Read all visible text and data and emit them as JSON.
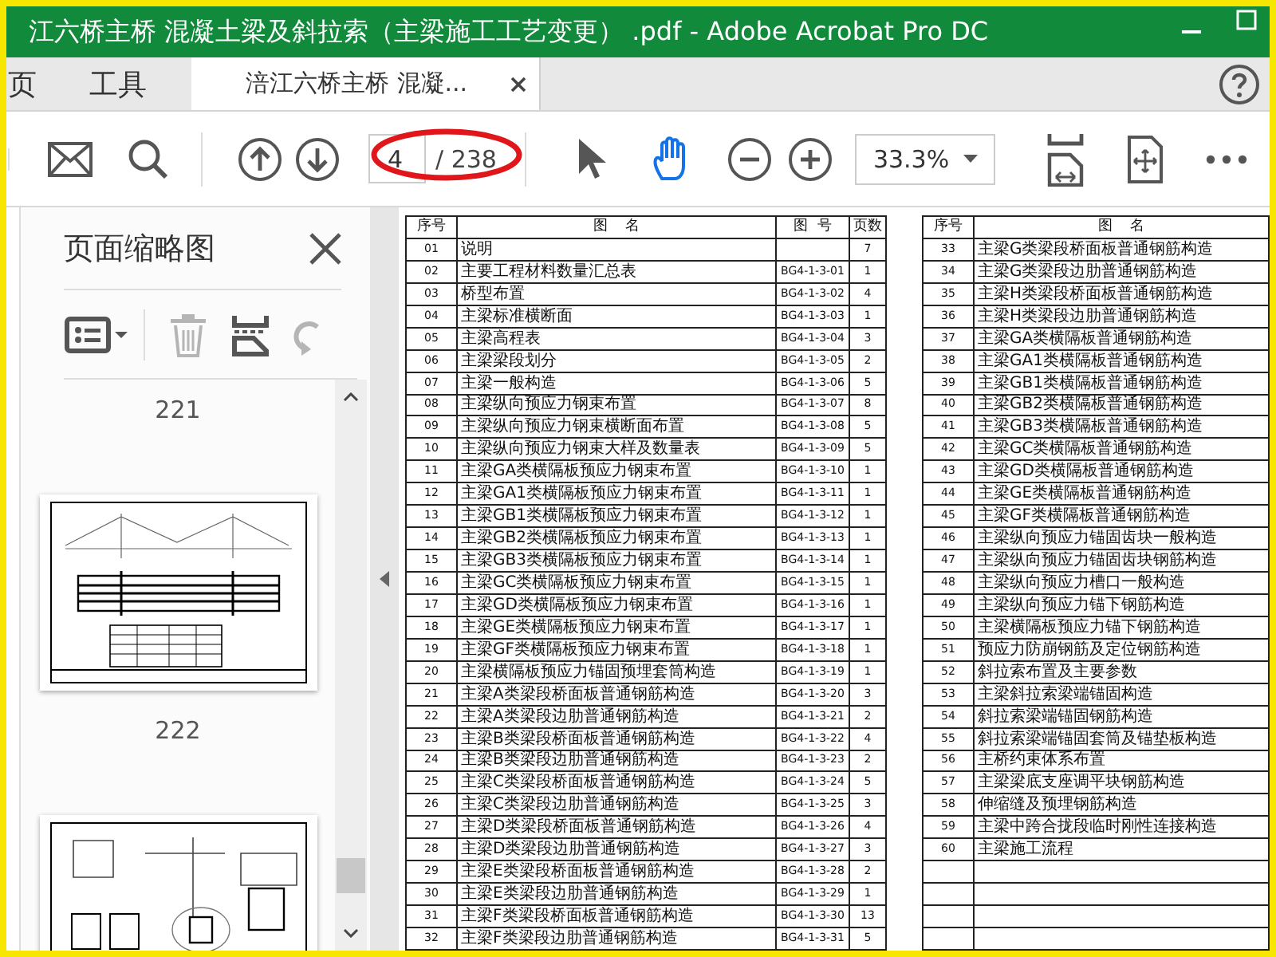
{
  "window": {
    "title": "江六桥主桥 混凝土梁及斜拉索（主梁施工工艺变更） .pdf - Adobe Acrobat Pro DC"
  },
  "tabs": [
    {
      "label": "页",
      "selected": false
    },
    {
      "label": "工具",
      "selected": false
    },
    {
      "label": "涪江六桥主桥 混凝...",
      "selected": true
    }
  ],
  "toolbar": {
    "page_field": {
      "value": "4"
    },
    "page_total": "/ 238",
    "zoom": "33.3%",
    "tools": [
      {
        "kind": "select",
        "selected": false
      },
      {
        "kind": "hand",
        "selected": true
      }
    ]
  },
  "sidebar": {
    "title": "页面缩略图",
    "tools": [
      {
        "kind": "options",
        "disabled": false
      },
      {
        "kind": "delete",
        "disabled": true
      },
      {
        "kind": "extract",
        "disabled": false
      },
      {
        "kind": "rotate",
        "disabled": true
      }
    ],
    "thumbnails": [
      {
        "page_label": "221"
      },
      {
        "page_label": "222"
      }
    ]
  },
  "document": {
    "tables": [
      {
        "columns": [
          "序号",
          "图    名",
          "图  号",
          "页数"
        ],
        "rows": [
          {
            "no": "01",
            "name": "说明",
            "pages": "7"
          },
          {
            "no": "02",
            "name": "主要工程材料数量汇总表",
            "code": "BG4-1-3-01",
            "pages": "1"
          },
          {
            "no": "03",
            "name": "桥型布置",
            "code": "BG4-1-3-02",
            "pages": "4"
          },
          {
            "no": "04",
            "name": "主梁标准横断面",
            "code": "BG4-1-3-03",
            "pages": "1"
          },
          {
            "no": "05",
            "name": "主梁高程表",
            "code": "BG4-1-3-04",
            "pages": "3"
          },
          {
            "no": "06",
            "name": "主梁梁段划分",
            "code": "BG4-1-3-05",
            "pages": "2"
          },
          {
            "no": "07",
            "name": "主梁一般构造",
            "code": "BG4-1-3-06",
            "pages": "5"
          },
          {
            "no": "08",
            "name": "主梁纵向预应力钢束布置",
            "code": "BG4-1-3-07",
            "pages": "8"
          },
          {
            "no": "09",
            "name": "主梁纵向预应力钢束横断面布置",
            "code": "BG4-1-3-08",
            "pages": "5"
          },
          {
            "no": "10",
            "name": "主梁纵向预应力钢束大样及数量表",
            "code": "BG4-1-3-09",
            "pages": "5"
          },
          {
            "no": "11",
            "name": "主梁GA类横隔板预应力钢束布置",
            "code": "BG4-1-3-10",
            "pages": "1"
          },
          {
            "no": "12",
            "name": "主梁GA1类横隔板预应力钢束布置",
            "code": "BG4-1-3-11",
            "pages": "1"
          },
          {
            "no": "13",
            "name": "主梁GB1类横隔板预应力钢束布置",
            "code": "BG4-1-3-12",
            "pages": "1"
          },
          {
            "no": "14",
            "name": "主梁GB2类横隔板预应力钢束布置",
            "code": "BG4-1-3-13",
            "pages": "1"
          },
          {
            "no": "15",
            "name": "主梁GB3类横隔板预应力钢束布置",
            "code": "BG4-1-3-14",
            "pages": "1"
          },
          {
            "no": "16",
            "name": "主梁GC类横隔板预应力钢束布置",
            "code": "BG4-1-3-15",
            "pages": "1"
          },
          {
            "no": "17",
            "name": "主梁GD类横隔板预应力钢束布置",
            "code": "BG4-1-3-16",
            "pages": "1"
          },
          {
            "no": "18",
            "name": "主梁GE类横隔板预应力钢束布置",
            "code": "BG4-1-3-17",
            "pages": "1"
          },
          {
            "no": "19",
            "name": "主梁GF类横隔板预应力钢束布置",
            "code": "BG4-1-3-18",
            "pages": "1"
          },
          {
            "no": "20",
            "name": "主梁横隔板预应力锚固预埋套筒构造",
            "code": "BG4-1-3-19",
            "pages": "1"
          },
          {
            "no": "21",
            "name": "主梁A类梁段桥面板普通钢筋构造",
            "code": "BG4-1-3-20",
            "pages": "3"
          },
          {
            "no": "22",
            "name": "主梁A类梁段边肋普通钢筋构造",
            "code": "BG4-1-3-21",
            "pages": "2"
          },
          {
            "no": "23",
            "name": "主梁B类梁段桥面板普通钢筋构造",
            "code": "BG4-1-3-22",
            "pages": "4"
          },
          {
            "no": "24",
            "name": "主梁B类梁段边肋普通钢筋构造",
            "code": "BG4-1-3-23",
            "pages": "2"
          },
          {
            "no": "25",
            "name": "主梁C类梁段桥面板普通钢筋构造",
            "code": "BG4-1-3-24",
            "pages": "5"
          },
          {
            "no": "26",
            "name": "主梁C类梁段边肋普通钢筋构造",
            "code": "BG4-1-3-25",
            "pages": "3"
          },
          {
            "no": "27",
            "name": "主梁D类梁段桥面板普通钢筋构造",
            "code": "BG4-1-3-26",
            "pages": "4"
          },
          {
            "no": "28",
            "name": "主梁D类梁段边肋普通钢筋构造",
            "code": "BG4-1-3-27",
            "pages": "3"
          },
          {
            "no": "29",
            "name": "主梁E类梁段桥面板普通钢筋构造",
            "code": "BG4-1-3-28",
            "pages": "2"
          },
          {
            "no": "30",
            "name": "主梁E类梁段边肋普通钢筋构造",
            "code": "BG4-1-3-29",
            "pages": "1"
          },
          {
            "no": "31",
            "name": "主梁F类梁段桥面板普通钢筋构造",
            "code": "BG4-1-3-30",
            "pages": "13"
          },
          {
            "no": "32",
            "name": "主梁F类梁段边肋普通钢筋构造",
            "code": "BG4-1-3-31",
            "pages": "5"
          }
        ]
      },
      {
        "columns": [
          "序号",
          "图    名"
        ],
        "rows": [
          {
            "no": "33",
            "name": "主梁G类梁段桥面板普通钢筋构造"
          },
          {
            "no": "34",
            "name": "主梁G类梁段边肋普通钢筋构造"
          },
          {
            "no": "35",
            "name": "主梁H类梁段桥面板普通钢筋构造"
          },
          {
            "no": "36",
            "name": "主梁H类梁段边肋普通钢筋构造"
          },
          {
            "no": "37",
            "name": "主梁GA类横隔板普通钢筋构造"
          },
          {
            "no": "38",
            "name": "主梁GA1类横隔板普通钢筋构造"
          },
          {
            "no": "39",
            "name": "主梁GB1类横隔板普通钢筋构造"
          },
          {
            "no": "40",
            "name": "主梁GB2类横隔板普通钢筋构造"
          },
          {
            "no": "41",
            "name": "主梁GB3类横隔板普通钢筋构造"
          },
          {
            "no": "42",
            "name": "主梁GC类横隔板普通钢筋构造"
          },
          {
            "no": "43",
            "name": "主梁GD类横隔板普通钢筋构造"
          },
          {
            "no": "44",
            "name": "主梁GE类横隔板普通钢筋构造"
          },
          {
            "no": "45",
            "name": "主梁GF类横隔板普通钢筋构造"
          },
          {
            "no": "46",
            "name": "主梁纵向预应力锚固齿块一般构造"
          },
          {
            "no": "47",
            "name": "主梁纵向预应力锚固齿块钢筋构造"
          },
          {
            "no": "48",
            "name": "主梁纵向预应力槽口一般构造"
          },
          {
            "no": "49",
            "name": "主梁纵向预应力锚下钢筋构造"
          },
          {
            "no": "50",
            "name": "主梁横隔板预应力锚下钢筋构造"
          },
          {
            "no": "51",
            "name": "预应力防崩钢筋及定位钢筋构造"
          },
          {
            "no": "52",
            "name": "斜拉索布置及主要参数"
          },
          {
            "no": "53",
            "name": "主梁斜拉索梁端锚固构造"
          },
          {
            "no": "54",
            "name": "斜拉索梁端锚固钢筋构造"
          },
          {
            "no": "55",
            "name": "斜拉索梁端锚固套筒及锚垫板构造"
          },
          {
            "no": "56",
            "name": "主桥约束体系布置"
          },
          {
            "no": "57",
            "name": "主梁梁底支座调平块钢筋构造"
          },
          {
            "no": "58",
            "name": "伸缩缝及预埋钢筋构造"
          },
          {
            "no": "59",
            "name": "主梁中跨合拢段临时刚性连接构造"
          },
          {
            "no": "60",
            "name": "主梁施工流程"
          }
        ]
      }
    ]
  }
}
